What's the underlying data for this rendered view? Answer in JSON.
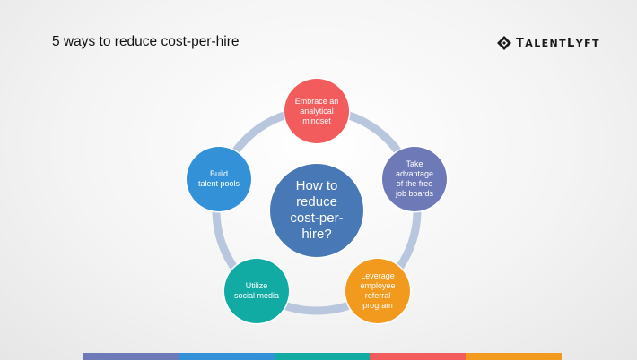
{
  "slide": {
    "title": "5 ways to reduce cost-per-hire"
  },
  "logo": {
    "first_letter": "T",
    "rest_1": "ALENT",
    "second_letter": "L",
    "rest_2": "YFT"
  },
  "diagram": {
    "center": {
      "text": "How to\nreduce\ncost-per-\nhire?",
      "color": "#4878b5"
    },
    "ring_color": "#b8c7dd",
    "nodes": [
      {
        "text": "Embrace an\nanalytical\nmindset",
        "color": "#f25c5c"
      },
      {
        "text": "Take\nadvantage\nof the free\njob boards",
        "color": "#6e79b7"
      },
      {
        "text": "Leverage\nemployee\nreferral\nprogram",
        "color": "#f29a1d"
      },
      {
        "text": "Utilize\nsocial media",
        "color": "#12aba3"
      },
      {
        "text": "Build\ntalent pools",
        "color": "#3391d8"
      }
    ]
  },
  "footer_bar_colors": [
    "#6e79b7",
    "#3391d8",
    "#12aba3",
    "#f25c5c",
    "#f29a1d"
  ]
}
